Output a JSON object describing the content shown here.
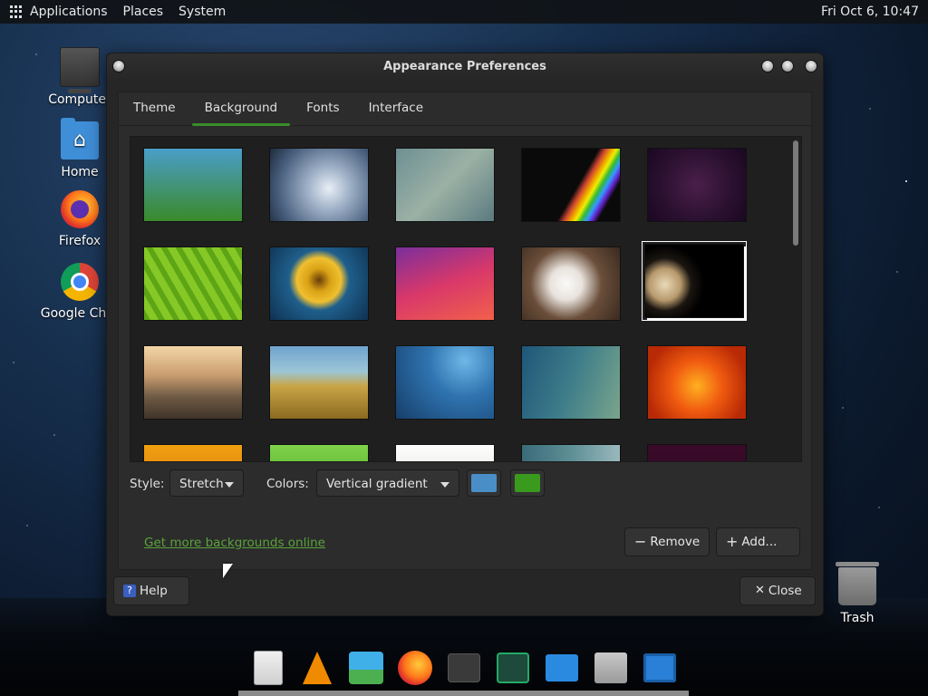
{
  "top_panel": {
    "menus": [
      "Applications",
      "Places",
      "System"
    ],
    "clock": "Fri Oct  6, 10:47"
  },
  "desktop": {
    "icons": [
      {
        "label": "Computer"
      },
      {
        "label": "Home"
      },
      {
        "label": "Firefox"
      },
      {
        "label": "Google Chro"
      },
      {
        "label": "Trash"
      }
    ]
  },
  "window": {
    "title": "Appearance Preferences",
    "tabs": [
      "Theme",
      "Background",
      "Fonts",
      "Interface"
    ],
    "active_tab": "Background",
    "thumbnails": [
      {
        "name": "green-blue-gradient",
        "bg": "linear-gradient(#4a9ec8,#3a8a2a)"
      },
      {
        "name": "water-drop",
        "bg": "radial-gradient(circle at 60% 55%,#e8eef6 0%,#9fb1c7 30%,#49607f 70%,#1d2a3b 100%)"
      },
      {
        "name": "soft-teal-blur",
        "bg": "linear-gradient(135deg,#6d8f92,#9bb1a5,#5b7a7f)"
      },
      {
        "name": "arch-prism",
        "bg": "linear-gradient(120deg,#0a0a0a 0%,#0a0a0a 55%,#c43 60%,#e90 64%,#ee0 68%,#3b3 72%,#39f 76%,#62c 80%,#0a0a0a 84%)"
      },
      {
        "name": "space-planets",
        "bg": "radial-gradient(circle at 50% 50%,#4a1f4a 0%,#2a1030 60%,#1a0820 100%)"
      },
      {
        "name": "green-leaf",
        "bg": "repeating-linear-gradient(60deg,#5ea516 0 6px,#86c926 6px 14px)"
      },
      {
        "name": "sunflower",
        "bg": "radial-gradient(circle at 50% 45%,#6b3c0a 0%,#d9a215 18%,#f0c030 35%,#1f5f8c 48%,#0e3150 100%)"
      },
      {
        "name": "pink-waves",
        "bg": "linear-gradient(160deg,#7a2f9c,#d8386a,#f2604a)"
      },
      {
        "name": "white-blossoms",
        "bg": "radial-gradient(circle at 45% 50%,#fafafa 0%,#e8e2dc 25%,#6a4e3a 55%,#3a2a1f 100%)"
      },
      {
        "name": "jupiter",
        "bg": "radial-gradient(circle at 20% 55%,#e9d9b8 0%,#b89a6d 18%,#1a1510 30%,#000 45%)"
      },
      {
        "name": "sunset-road",
        "bg": "linear-gradient(#f3d6a6 0%,#c99d70 40%,#6e5a45 70%,#3f3428 100%)"
      },
      {
        "name": "grass-beach",
        "bg": "linear-gradient(#6fa3cf 0%,#9cc5d6 35%,#c9a547 55%,#8a6a20 100%)"
      },
      {
        "name": "blue-abstract",
        "bg": "radial-gradient(circle at 70% 20%,#6fb8e8 0%,#2f74b0 40%,#163e6a 100%)"
      },
      {
        "name": "teal-bokeh",
        "bg": "linear-gradient(110deg,#1f5678,#3e7d8a,#7aa58c)"
      },
      {
        "name": "orange-flower",
        "bg": "radial-gradient(circle at 50% 55%,#ffb020 0%,#f05a10 40%,#b82a05 80%)"
      },
      {
        "name": "yellow-flower-partial",
        "bg": "linear-gradient(#f0a010,#d86a10)"
      },
      {
        "name": "green-grass-partial",
        "bg": "linear-gradient(#7fd24a,#3e9a1c)"
      },
      {
        "name": "white-partial",
        "bg": "linear-gradient(#fdfdfd,#d8ddd0)"
      },
      {
        "name": "teal-partial",
        "bg": "linear-gradient(90deg,#3a6b7a,#5d8f95,#9ab8bd)"
      },
      {
        "name": "purple-partial",
        "bg": "linear-gradient(#3a0a2a,#2a0a1e)"
      }
    ],
    "selected_thumbnail": "jupiter",
    "style_label": "Style:",
    "style_value": "Stretch",
    "colors_label": "Colors:",
    "colors_value": "Vertical gradient",
    "color1": "#4a8ec7",
    "color2": "#3a9a1e",
    "link": "Get more backgrounds online",
    "remove_label": "Remove",
    "add_label": "Add...",
    "help_label": "Help",
    "close_label": "Close"
  },
  "dock": {
    "items": [
      "text-editor-icon",
      "vlc-icon",
      "image-viewer-icon",
      "firefox-icon",
      "terminal-icon",
      "system-monitor-icon",
      "blank-window-icon",
      "archive-manager-icon",
      "workspace-switcher-icon"
    ]
  }
}
